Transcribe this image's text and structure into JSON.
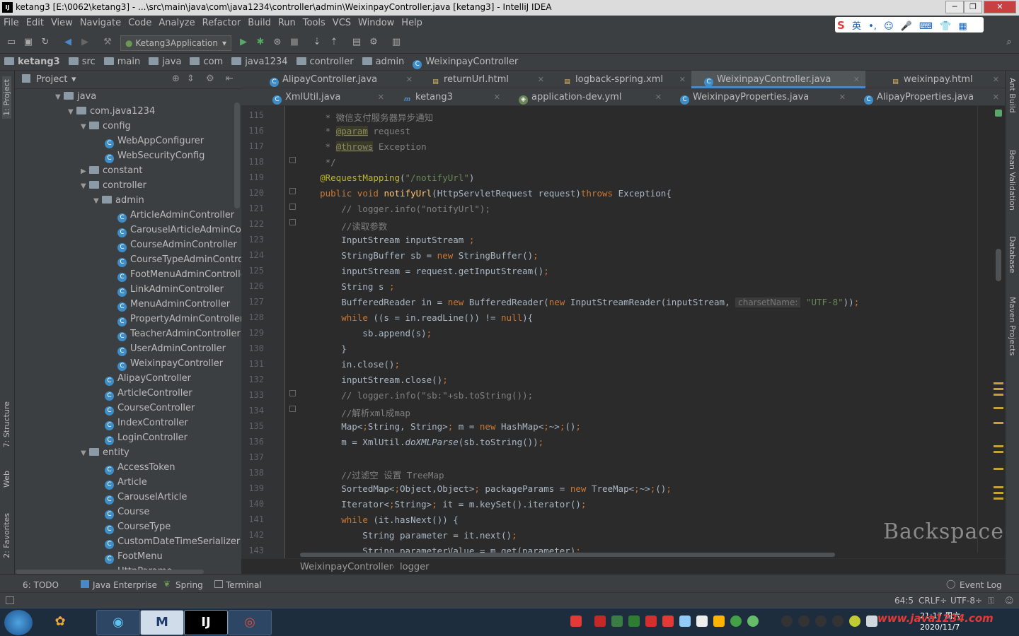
{
  "window": {
    "title": "ketang3 [E:\\0062\\ketang3] - ...\\src\\main\\java\\com\\java1234\\controller\\admin\\WeixinpayController.java [ketang3] - IntelliJ IDEA",
    "app_icon_label": "IJ",
    "min": "─",
    "max": "❐",
    "close": "✕"
  },
  "menu": [
    "File",
    "Edit",
    "View",
    "Navigate",
    "Code",
    "Analyze",
    "Refactor",
    "Build",
    "Run",
    "Tools",
    "VCS",
    "Window",
    "Help"
  ],
  "ime": {
    "lang": "英",
    "items": [
      "•,",
      "☺",
      "🎤",
      "⌨",
      "👕",
      "▦"
    ]
  },
  "toolbar": {
    "run_config": "Ketang3Application"
  },
  "navbar": [
    "ketang3",
    "src",
    "main",
    "java",
    "com",
    "java1234",
    "controller",
    "admin",
    "WeixinpayController"
  ],
  "project_panel": {
    "title": "Project",
    "dropdown": "▾"
  },
  "tree": [
    {
      "label": "java",
      "depth": 0,
      "type": "folder",
      "open": true
    },
    {
      "label": "com.java1234",
      "depth": 1,
      "type": "folder",
      "open": true
    },
    {
      "label": "config",
      "depth": 2,
      "type": "folder",
      "open": true
    },
    {
      "label": "WebAppConfigurer",
      "depth": 3,
      "type": "class"
    },
    {
      "label": "WebSecurityConfig",
      "depth": 3,
      "type": "class"
    },
    {
      "label": "constant",
      "depth": 2,
      "type": "folder",
      "open": false
    },
    {
      "label": "controller",
      "depth": 2,
      "type": "folder",
      "open": true
    },
    {
      "label": "admin",
      "depth": 3,
      "type": "folder",
      "open": true
    },
    {
      "label": "ArticleAdminController",
      "depth": 4,
      "type": "class"
    },
    {
      "label": "CarouselArticleAdminContr",
      "depth": 4,
      "type": "class"
    },
    {
      "label": "CourseAdminController",
      "depth": 4,
      "type": "class"
    },
    {
      "label": "CourseTypeAdminControlle",
      "depth": 4,
      "type": "class"
    },
    {
      "label": "FootMenuAdminController",
      "depth": 4,
      "type": "class"
    },
    {
      "label": "LinkAdminController",
      "depth": 4,
      "type": "class"
    },
    {
      "label": "MenuAdminController",
      "depth": 4,
      "type": "class"
    },
    {
      "label": "PropertyAdminController",
      "depth": 4,
      "type": "class"
    },
    {
      "label": "TeacherAdminController",
      "depth": 4,
      "type": "class"
    },
    {
      "label": "UserAdminController",
      "depth": 4,
      "type": "class"
    },
    {
      "label": "WeixinpayController",
      "depth": 4,
      "type": "class"
    },
    {
      "label": "AlipayController",
      "depth": 3,
      "type": "class"
    },
    {
      "label": "ArticleController",
      "depth": 3,
      "type": "class"
    },
    {
      "label": "CourseController",
      "depth": 3,
      "type": "class"
    },
    {
      "label": "IndexController",
      "depth": 3,
      "type": "class"
    },
    {
      "label": "LoginController",
      "depth": 3,
      "type": "class"
    },
    {
      "label": "entity",
      "depth": 2,
      "type": "folder",
      "open": true
    },
    {
      "label": "AccessToken",
      "depth": 3,
      "type": "class"
    },
    {
      "label": "Article",
      "depth": 3,
      "type": "class"
    },
    {
      "label": "CarouselArticle",
      "depth": 3,
      "type": "class"
    },
    {
      "label": "Course",
      "depth": 3,
      "type": "class"
    },
    {
      "label": "CourseType",
      "depth": 3,
      "type": "class"
    },
    {
      "label": "CustomDateTimeSerializer",
      "depth": 3,
      "type": "class"
    },
    {
      "label": "FootMenu",
      "depth": 3,
      "type": "class"
    },
    {
      "label": "HttpParame",
      "depth": 3,
      "type": "class"
    }
  ],
  "tabs_row1": [
    {
      "label": "AlipayController.java",
      "icon": "class-icon",
      "active": false
    },
    {
      "label": "returnUrl.html",
      "icon": "html-icon",
      "active": false
    },
    {
      "label": "logback-spring.xml",
      "icon": "xml-icon",
      "active": false
    },
    {
      "label": "WeixinpayController.java",
      "icon": "class-icon",
      "active": true
    },
    {
      "label": "weixinpay.html",
      "icon": "html-icon",
      "active": false
    }
  ],
  "tabs_row2": [
    {
      "label": "XmlUtil.java",
      "icon": "class-icon"
    },
    {
      "label": "ketang3",
      "icon": "maven-icon"
    },
    {
      "label": "application-dev.yml",
      "icon": "yml-icon"
    },
    {
      "label": "WeixinpayProperties.java",
      "icon": "class-icon"
    },
    {
      "label": "AlipayProperties.java",
      "icon": "class-icon"
    }
  ],
  "line_numbers": [
    "115",
    "116",
    "117",
    "118",
    "119",
    "120",
    "121",
    "122",
    "123",
    "124",
    "125",
    "126",
    "127",
    "128",
    "129",
    "130",
    "131",
    "132",
    "133",
    "134",
    "135",
    "136",
    "137",
    "138",
    "139",
    "140",
    "141",
    "142",
    "143"
  ],
  "code": [
    "     * 微信支付服务器异步通知",
    "     * @param request",
    "     * @throws Exception",
    "     */",
    "    @RequestMapping(\"/notifyUrl\")",
    "    public void notifyUrl(HttpServletRequest request)throws Exception{",
    "        // logger.info(\"notifyUrl\");",
    "        //读取参数",
    "        InputStream inputStream ;",
    "        StringBuffer sb = new StringBuffer();",
    "        inputStream = request.getInputStream();",
    "        String s ;",
    "        BufferedReader in = new BufferedReader(new InputStreamReader(inputStream, charsetName: \"UTF-8\"));",
    "        while ((s = in.readLine()) != null){",
    "            sb.append(s);",
    "        }",
    "        in.close();",
    "        inputStream.close();",
    "        // logger.info(\"sb:\"+sb.toString());",
    "        //解析xml成map",
    "        Map<String, String> m = new HashMap<~>();",
    "        m = XmlUtil.doXMLParse(sb.toString());",
    "",
    "        //过滤空 设置 TreeMap",
    "        SortedMap<Object,Object> packageParams = new TreeMap<~>();",
    "        Iterator<String> it = m.keySet().iterator();",
    "        while (it.hasNext()) {",
    "            String parameter = it.next();",
    "            String parameterValue = m.get(parameter);"
  ],
  "overlay_key": "Backspace",
  "editor_breadcrumb": [
    "WeixinpayController",
    "logger"
  ],
  "bottom_tabs": [
    "6: TODO",
    "Java Enterprise",
    "Spring",
    "Terminal"
  ],
  "event_log": "Event Log",
  "status": {
    "position": "64:5",
    "line_sep": "CRLF÷",
    "encoding": "UTF-8÷"
  },
  "left_strip": [
    "1: Project",
    "7: Structure",
    "Web",
    "2: Favorites"
  ],
  "right_strip": [
    "Ant Build",
    "Bean Validation",
    "Database",
    "Maven Projects"
  ],
  "taskbar": {
    "time": "21:17 周六",
    "date": "2020/11/7",
    "watermark": "www.java1234.com"
  },
  "colors": {
    "accent": "#4a88c7",
    "keyword": "#cc7832",
    "string": "#6a8759",
    "comment": "#808080",
    "annotation": "#bbb529",
    "method": "#ffc66d"
  }
}
